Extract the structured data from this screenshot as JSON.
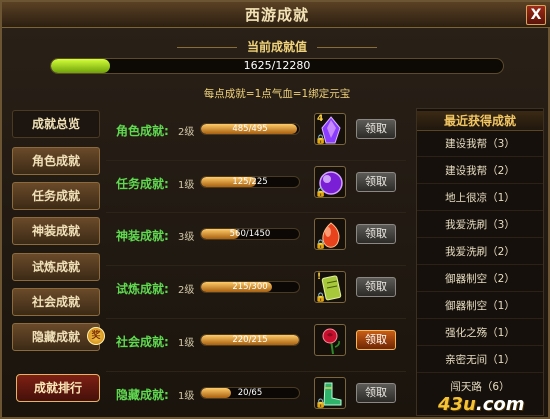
{
  "window": {
    "title": "西游成就",
    "close_label": "X"
  },
  "progress": {
    "title": "当前成就值",
    "value_text": "1625/12280",
    "fraction": 0.1323,
    "note": "每点成就=1点气血=1绑定元宝"
  },
  "sidebar": {
    "tabs": [
      {
        "label": "成就总览",
        "active": true
      },
      {
        "label": "角色成就",
        "active": false
      },
      {
        "label": "任务成就",
        "active": false
      },
      {
        "label": "神装成就",
        "active": false
      },
      {
        "label": "试炼成就",
        "active": false
      },
      {
        "label": "社会成就",
        "active": false
      },
      {
        "label": "隐藏成就",
        "active": false,
        "badge": "奖"
      }
    ],
    "rank_button": "成就排行"
  },
  "categories": [
    {
      "label": "角色成就:",
      "level": "2级",
      "progress": "485/495",
      "fraction": 0.98,
      "item_icon": "purple-crystal-icon",
      "count": "4",
      "claim_label": "领取",
      "ready": false
    },
    {
      "label": "任务成就:",
      "level": "1级",
      "progress": "125/225",
      "fraction": 0.556,
      "item_icon": "purple-orb-icon",
      "count": "",
      "claim_label": "领取",
      "ready": false
    },
    {
      "label": "神装成就:",
      "level": "3级",
      "progress": "560/1450",
      "fraction": 0.386,
      "item_icon": "red-gem-icon",
      "count": "",
      "claim_label": "领取",
      "ready": false
    },
    {
      "label": "试炼成就:",
      "level": "2级",
      "progress": "215/300",
      "fraction": 0.717,
      "item_icon": "green-scroll-icon",
      "count": "!",
      "claim_label": "领取",
      "ready": false
    },
    {
      "label": "社会成就:",
      "level": "1级",
      "progress": "220/215",
      "fraction": 1.0,
      "item_icon": "rose-icon",
      "count": "",
      "claim_label": "领取",
      "ready": true
    },
    {
      "label": "隐藏成就:",
      "level": "1级",
      "progress": "20/65",
      "fraction": 0.308,
      "item_icon": "green-boots-icon",
      "count": "",
      "claim_label": "领取",
      "ready": false
    }
  ],
  "recent": {
    "title": "最近获得成就",
    "items": [
      "建设我帮（3）",
      "建设我帮（2）",
      "地上很凉（1）",
      "我爱洗刷（3）",
      "我爱洗刷（2）",
      "御器制空（2）",
      "御器制空（1）",
      "强化之殇（1）",
      "亲密无间（1）",
      "闯天路（6）"
    ]
  },
  "watermark": {
    "brand": "43u",
    "suffix": ".com"
  }
}
